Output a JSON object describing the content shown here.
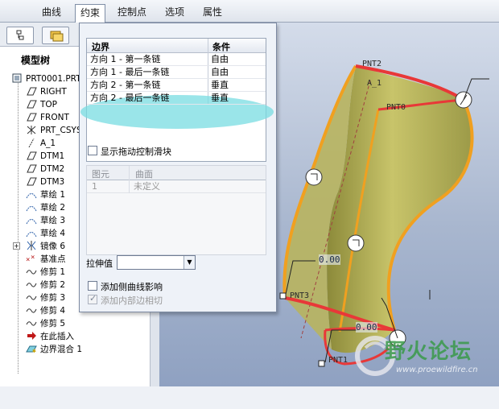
{
  "tabs": [
    {
      "label": "曲线",
      "active": false
    },
    {
      "label": "约束",
      "active": true
    },
    {
      "label": "控制点",
      "active": false
    },
    {
      "label": "选项",
      "active": false
    },
    {
      "label": "属性",
      "active": false
    }
  ],
  "model_tree": {
    "title": "模型树",
    "items": [
      {
        "label": "PRT0001.PRT",
        "icon": "part-icon"
      },
      {
        "label": "RIGHT",
        "icon": "datum-plane-icon"
      },
      {
        "label": "TOP",
        "icon": "datum-plane-icon"
      },
      {
        "label": "FRONT",
        "icon": "datum-plane-icon"
      },
      {
        "label": "PRT_CSYS_DEF",
        "icon": "csys-icon"
      },
      {
        "label": "A_1",
        "icon": "datum-axis-icon"
      },
      {
        "label": "DTM1",
        "icon": "datum-plane-icon"
      },
      {
        "label": "DTM2",
        "icon": "datum-plane-icon"
      },
      {
        "label": "DTM3",
        "icon": "datum-plane-icon"
      },
      {
        "label": "草绘 1",
        "icon": "sketch-icon"
      },
      {
        "label": "草绘 2",
        "icon": "sketch-icon"
      },
      {
        "label": "草绘 3",
        "icon": "sketch-icon"
      },
      {
        "label": "草绘 4",
        "icon": "sketch-icon"
      },
      {
        "label": "镜像 6",
        "icon": "mirror-icon"
      },
      {
        "label": "基准点",
        "icon": "datum-point-icon"
      },
      {
        "label": "修剪 1",
        "icon": "trim-icon"
      },
      {
        "label": "修剪 2",
        "icon": "trim-icon"
      },
      {
        "label": "修剪 3",
        "icon": "trim-icon"
      },
      {
        "label": "修剪 4",
        "icon": "trim-icon"
      },
      {
        "label": "修剪 5",
        "icon": "trim-icon"
      },
      {
        "label": "在此插入",
        "icon": "insert-arrow-icon"
      },
      {
        "label": "边界混合 1",
        "icon": "boundary-blend-icon"
      }
    ]
  },
  "constraints": {
    "boundary_header": "边界",
    "condition_header": "条件",
    "rows": [
      {
        "boundary": "方向 1 - 第一条链",
        "condition": "自由"
      },
      {
        "boundary": "方向 1 - 最后一条链",
        "condition": "自由"
      },
      {
        "boundary": "方向 2 - 第一条链",
        "condition": "垂直"
      },
      {
        "boundary": "方向 2 - 最后一条链",
        "condition": "垂直"
      }
    ],
    "show_drag_handles_label": "显示拖动控制滑块",
    "curve_table": {
      "element_header": "图元",
      "surface_header": "曲面",
      "rows": [
        {
          "element": "1",
          "surface": "未定义"
        }
      ]
    },
    "tension_label": "拉伸值",
    "tension_value": "",
    "add_side_curve_label": "添加侧曲线影响",
    "add_inner_edge_label": "添加内部边相切"
  },
  "viewport": {
    "labels": {
      "pnt2": "PNT2",
      "a1": "A_1",
      "pnt0": "PNT0",
      "pnt3": "PNT3",
      "pnt1": "PNT1",
      "val_top": "0.00",
      "val_bottom": "0.00"
    }
  },
  "watermark": {
    "title": "野火论坛",
    "url": "www.proewildfire.cn"
  },
  "colors": {
    "surface": "#b5b25a",
    "boundary_free": "#f0a020",
    "boundary_normal": "#e83838",
    "highlight": "#78dce1"
  }
}
